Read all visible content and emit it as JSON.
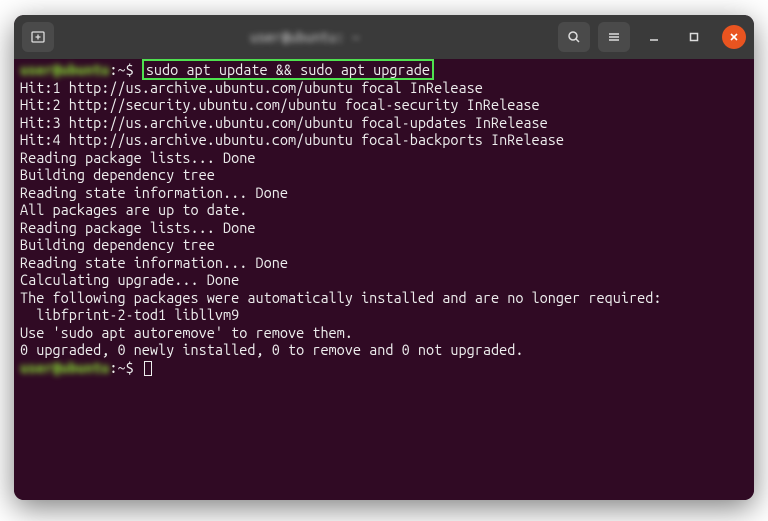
{
  "titlebar": {
    "title": "user@ubuntu: ~"
  },
  "prompt": {
    "user_host": "user@ubuntu",
    "path": ":~$ ",
    "command": "sudo apt update && sudo apt upgrade"
  },
  "output": [
    "Hit:1 http://us.archive.ubuntu.com/ubuntu focal InRelease",
    "Hit:2 http://security.ubuntu.com/ubuntu focal-security InRelease",
    "Hit:3 http://us.archive.ubuntu.com/ubuntu focal-updates InRelease",
    "Hit:4 http://us.archive.ubuntu.com/ubuntu focal-backports InRelease",
    "Reading package lists... Done",
    "Building dependency tree",
    "Reading state information... Done",
    "All packages are up to date.",
    "Reading package lists... Done",
    "Building dependency tree",
    "Reading state information... Done",
    "Calculating upgrade... Done",
    "The following packages were automatically installed and are no longer required:",
    "  libfprint-2-tod1 libllvm9",
    "Use 'sudo apt autoremove' to remove them.",
    "0 upgraded, 0 newly installed, 0 to remove and 0 not upgraded."
  ],
  "prompt2": {
    "user_host": "user@ubuntu",
    "path": ":~$ "
  }
}
